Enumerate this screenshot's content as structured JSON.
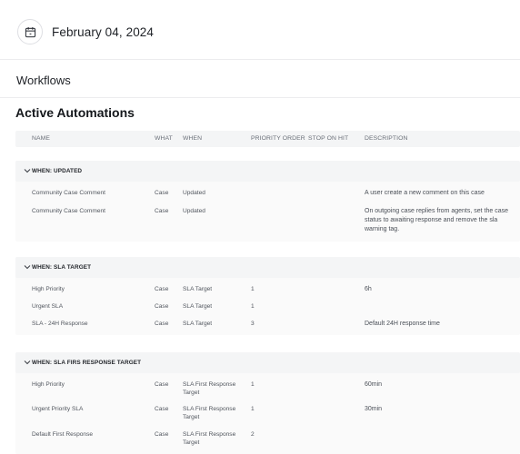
{
  "date": {
    "label": "February 04, 2024",
    "icon": "calendar-icon"
  },
  "page": {
    "title": "Workflows",
    "section_title": "Active Automations"
  },
  "columns": {
    "name": "NAME",
    "what": "WHAT",
    "when": "WHEN",
    "priority": "PRIORITY ORDER",
    "stop": "STOP ON HIT",
    "description": "DESCRIPTION"
  },
  "groups": [
    {
      "label": "WHEN: UPDATED",
      "rows": [
        {
          "name": "Community Case Comment",
          "what": "Case",
          "when": "Updated",
          "priority": "",
          "description": "A user create a new comment on this case"
        },
        {
          "name": "Community Case Comment",
          "what": "Case",
          "when": "Updated",
          "priority": "",
          "description": "On outgoing case replies from agents, set the case status to awaiting response and remove the sla warning tag."
        }
      ]
    },
    {
      "label": "WHEN: SLA TARGET",
      "rows": [
        {
          "name": "High Priority",
          "what": "Case",
          "when": "SLA Target",
          "priority": "1",
          "description": "6h"
        },
        {
          "name": "Urgent SLA",
          "what": "Case",
          "when": "SLA Target",
          "priority": "1",
          "description": ""
        },
        {
          "name": "SLA - 24H Response",
          "what": "Case",
          "when": "SLA Target",
          "priority": "3",
          "description": "Default 24H response time"
        }
      ]
    },
    {
      "label": "WHEN: SLA FIRS RESPONSE TARGET",
      "rows": [
        {
          "name": "High Priority",
          "what": "Case",
          "when": "SLA First Response Target",
          "priority": "1",
          "description": "60min"
        },
        {
          "name": "Urgent Priority SLA",
          "what": "Case",
          "when": "SLA First Response Target",
          "priority": "1",
          "description": "30min"
        },
        {
          "name": "Default First Response",
          "what": "Case",
          "when": "SLA First Response Target",
          "priority": "2",
          "description": ""
        }
      ]
    }
  ]
}
